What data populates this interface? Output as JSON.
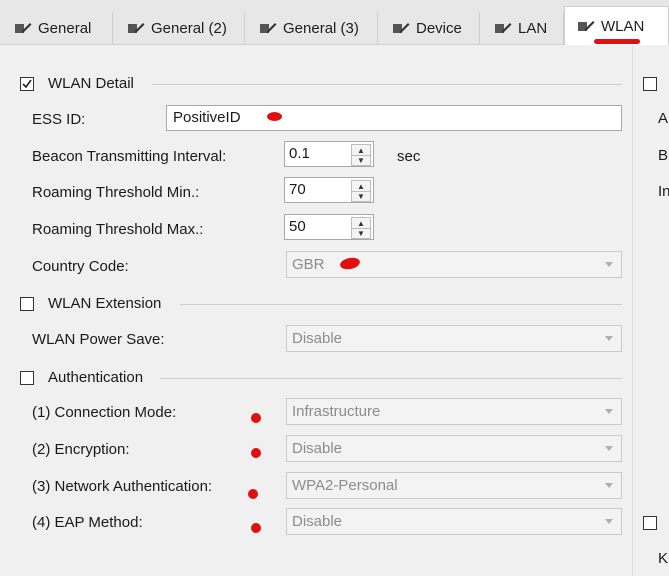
{
  "tabs": [
    {
      "label": "General"
    },
    {
      "label": "General (2)"
    },
    {
      "label": "General (3)"
    },
    {
      "label": "Device"
    },
    {
      "label": "LAN"
    },
    {
      "label": "WLAN"
    }
  ],
  "wlan_detail": {
    "title": "WLAN Detail",
    "checked": true,
    "ess_id": {
      "label": "ESS ID:",
      "value": "PositiveID"
    },
    "beacon_interval": {
      "label": "Beacon Transmitting Interval:",
      "value": "0.1",
      "unit": "sec"
    },
    "roaming_min": {
      "label": "Roaming Threshold Min.:",
      "value": "70"
    },
    "roaming_max": {
      "label": "Roaming Threshold Max.:",
      "value": "50"
    },
    "country_code": {
      "label": "Country Code:",
      "value": "GBR"
    }
  },
  "wlan_extension": {
    "title": "WLAN Extension",
    "checked": false,
    "power_save": {
      "label": "WLAN Power Save:",
      "value": "Disable"
    }
  },
  "authentication": {
    "title": "Authentication",
    "checked": false,
    "connection_mode": {
      "label": "(1) Connection Mode:",
      "value": "Infrastructure"
    },
    "encryption": {
      "label": "(2) Encryption:",
      "value": "Disable"
    },
    "network_auth": {
      "label": "(3) Network Authentication:",
      "value": "WPA2-Personal"
    },
    "eap_method": {
      "label": "(4) EAP Method:",
      "value": "Disable"
    }
  },
  "right_strip": {
    "letters": [
      "A",
      "B",
      "In",
      "K"
    ]
  },
  "colors": {
    "annotation_red": "#e01010",
    "window_bg": "#f0f0f0"
  }
}
